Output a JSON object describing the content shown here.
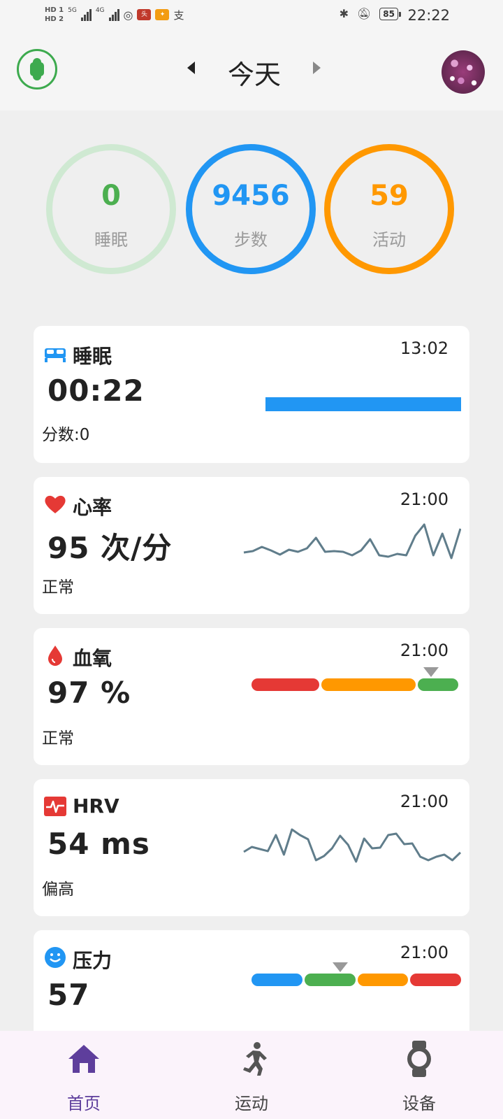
{
  "status_bar": {
    "hd_top": "HD 1",
    "hd_bottom": "HD 2",
    "net1": "5G",
    "net2": "4G",
    "battery": "85",
    "time": "22:22"
  },
  "header": {
    "title": "今天"
  },
  "summary": {
    "sleep": {
      "value": "0",
      "label": "睡眠"
    },
    "steps": {
      "value": "9456",
      "label": "步数"
    },
    "activity": {
      "value": "59",
      "label": "活动"
    }
  },
  "cards": {
    "sleep": {
      "title": "睡眠",
      "time": "13:02",
      "value": "00:22",
      "sub": "分数:0",
      "icon": "bed-icon",
      "color": "#2196f3"
    },
    "heart_rate": {
      "title": "心率",
      "time": "21:00",
      "value": "95 次/分",
      "sub": "正常",
      "icon": "heart-icon",
      "color": "#e53935",
      "trend": [
        58,
        56,
        50,
        55,
        61,
        54,
        57,
        52,
        37,
        57,
        56,
        57,
        62,
        55,
        39,
        62,
        64,
        60,
        62,
        34,
        18,
        62,
        31,
        66,
        24
      ]
    },
    "spo2": {
      "title": "血氧",
      "time": "21:00",
      "value": "97 %",
      "sub": "正常",
      "icon": "drop-icon"
    },
    "hrv": {
      "title": "HRV",
      "time": "21:00",
      "value": "54 ms",
      "sub": "偏高",
      "icon": "pulse-icon",
      "trend": [
        54,
        47,
        50,
        53,
        30,
        58,
        22,
        30,
        36,
        66,
        60,
        49,
        31,
        44,
        68,
        35,
        49,
        48,
        30,
        28,
        43,
        42,
        61,
        66,
        61,
        58,
        66,
        55
      ]
    },
    "stress": {
      "title": "压力",
      "time": "21:00",
      "value": "57",
      "icon": "smiley-icon"
    }
  },
  "colors": {
    "green": "#4caf50",
    "blue": "#2196f3",
    "orange": "#ff9800",
    "red": "#e53935",
    "line": "#607d8b",
    "accent_nav": "#5e3e9c"
  },
  "bottom_nav": {
    "home": "首页",
    "sport": "运动",
    "device": "设备"
  }
}
